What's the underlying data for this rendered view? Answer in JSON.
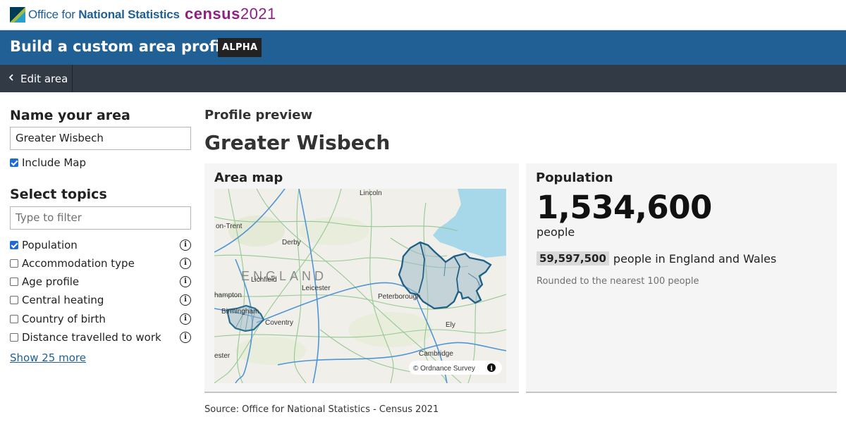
{
  "header": {
    "ons_text_plain": "Office for ",
    "ons_text_bold": "National Statistics",
    "census_word": "census",
    "census_year": "2021"
  },
  "titlebar": {
    "title": "Build a custom area profile",
    "badge": "ALPHA"
  },
  "nav": {
    "back_label": "Edit area"
  },
  "sidebar": {
    "name_heading": "Name your area",
    "name_value": "Greater Wisbech",
    "include_map_label": "Include Map",
    "include_map_checked": true,
    "topics_heading": "Select topics",
    "filter_placeholder": "Type to filter",
    "topics": [
      {
        "label": "Population",
        "checked": true
      },
      {
        "label": "Accommodation type",
        "checked": false
      },
      {
        "label": "Age profile",
        "checked": false
      },
      {
        "label": "Central heating",
        "checked": false
      },
      {
        "label": "Country of birth",
        "checked": false
      },
      {
        "label": "Distance travelled to work",
        "checked": false
      }
    ],
    "show_more": "Show 25 more"
  },
  "main": {
    "preview_heading": "Profile preview",
    "area_name": "Greater Wisbech",
    "map_card": {
      "heading": "Area map",
      "attribution": "© Ordnance Survey",
      "country_label": "ENGLAND",
      "place_labels": [
        "Lincoln",
        "on-Trent",
        "Derby",
        "Lichfield",
        "Leicester",
        "Peterborough",
        "hampton",
        "Birmingham",
        "Coventry",
        "Ely",
        "Cambridge",
        "ester"
      ]
    },
    "population_card": {
      "heading": "Population",
      "value": "1,534,600",
      "unit": "people",
      "comparison_value": "59,597,500",
      "comparison_text": "people in England and Wales",
      "note": "Rounded to the nearest 100 people"
    },
    "source": "Source: Office for National Statistics - Census 2021"
  },
  "colors": {
    "brand_blue": "#206095",
    "nav_dark": "#323a45",
    "census_purple": "#902082",
    "checkbox_blue": "#1f6ad8",
    "card_bg": "#f5f5f5"
  }
}
